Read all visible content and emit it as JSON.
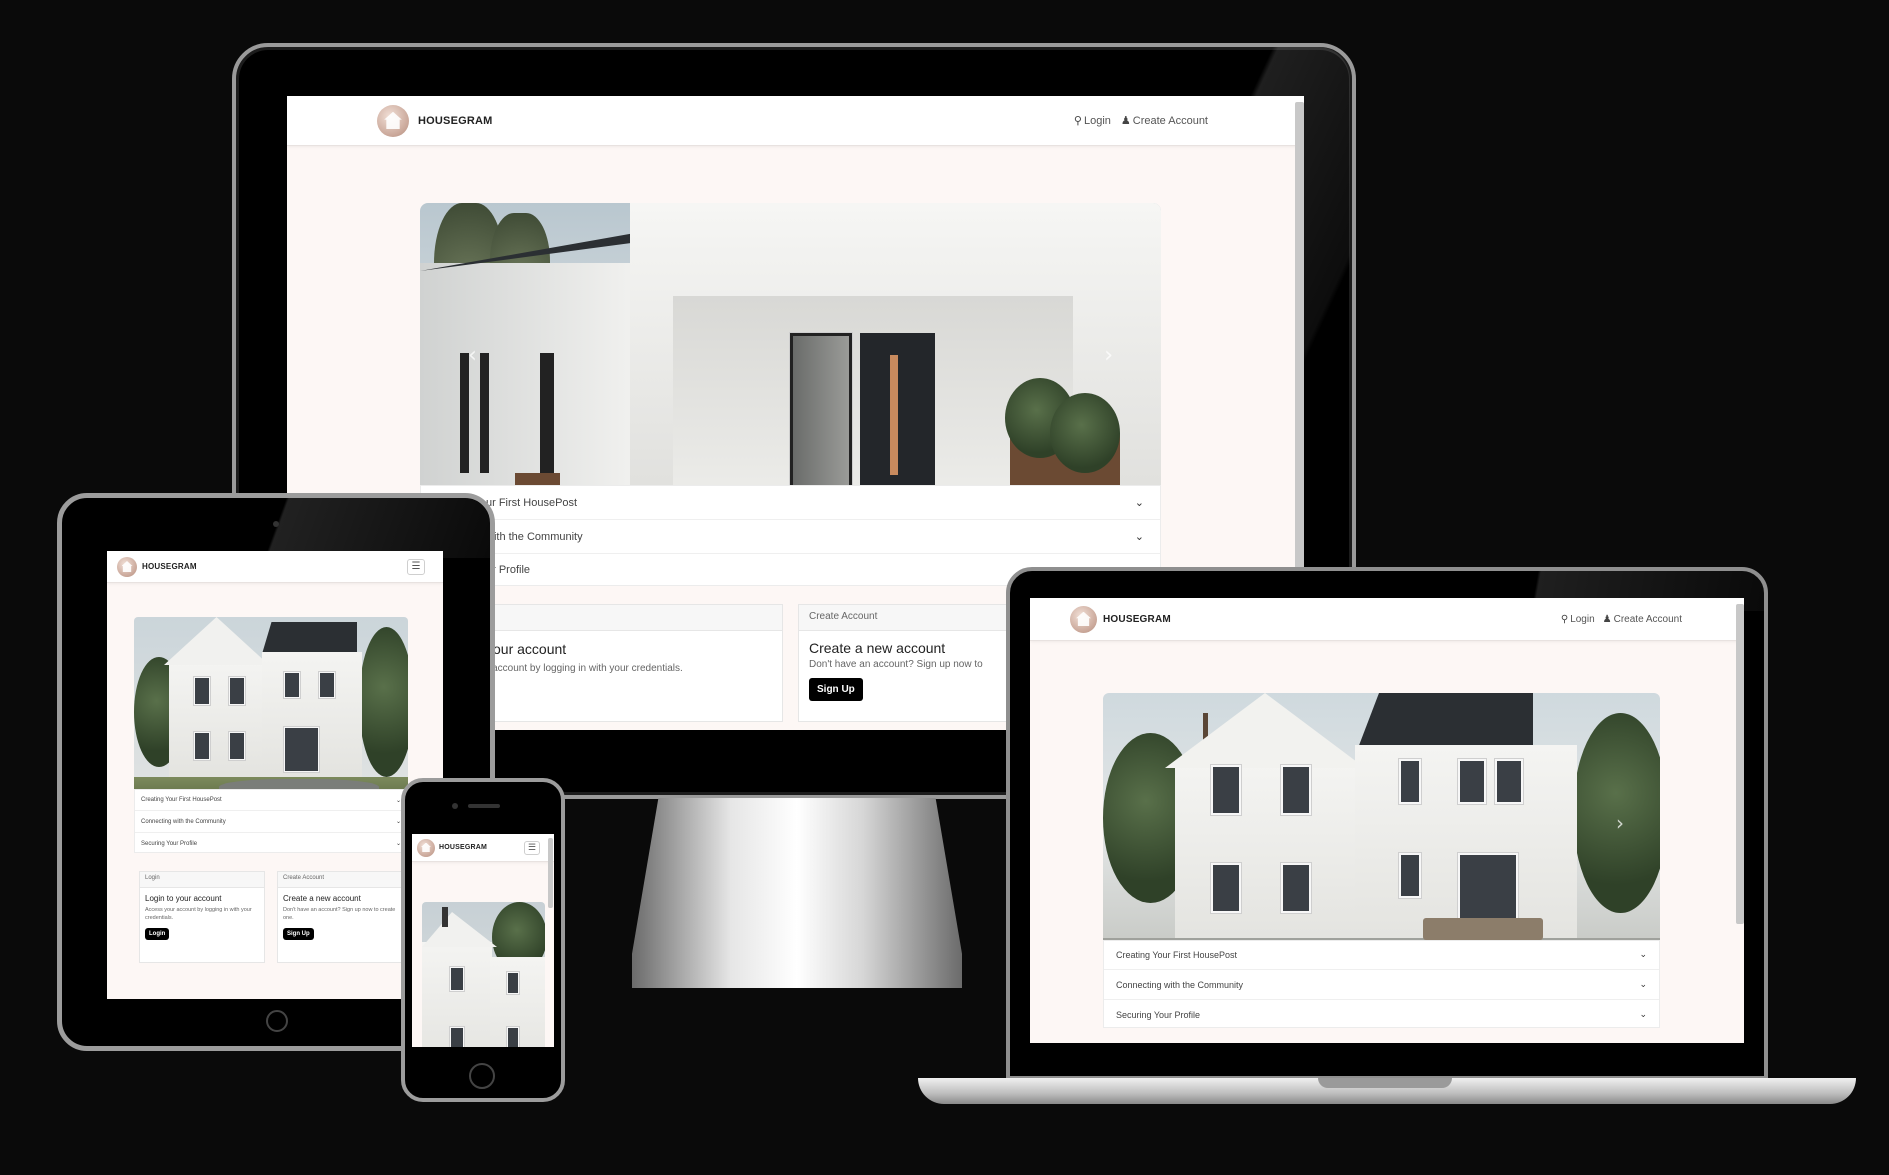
{
  "site": {
    "brand": "HOUSEGRAM",
    "nav": {
      "login": "Login",
      "create_account": "Create Account"
    },
    "accordion": [
      "Creating Your First HousePost",
      "Connecting with the Community",
      "Securing Your Profile"
    ],
    "login_card": {
      "header": "Login",
      "title": "Login to your account",
      "text": "Access your account by logging in with your credentials.",
      "button": "Login"
    },
    "create_card": {
      "header": "Create Account",
      "title": "Create a new account",
      "text": "Don't have an account? Sign up now to create one.",
      "button": "Sign Up"
    }
  },
  "monitor_partial": {
    "accordion": [
      "ur First HousePost",
      "with the Community",
      "ur Profile"
    ],
    "login_title": "your account",
    "login_text": "r account by logging in with your credentials.",
    "create_text": "Don't have an account? Sign up now to"
  },
  "tablet_partial": {
    "login_text": "Access your account by logging in with your credentials.",
    "create_text": "Don't have an account? Sign up now to create one."
  },
  "icons": {
    "login": "key-icon",
    "create_account": "person-plus-icon",
    "accordion": "chevron-down-icon",
    "menu": "hamburger-icon",
    "carousel_prev": "chevron-left-icon",
    "carousel_next": "chevron-right-icon"
  },
  "colors": {
    "page_bg": "#0a0a0a",
    "site_bg": "#fdf7f5",
    "button": "#000000",
    "logo": "#c9a698"
  }
}
